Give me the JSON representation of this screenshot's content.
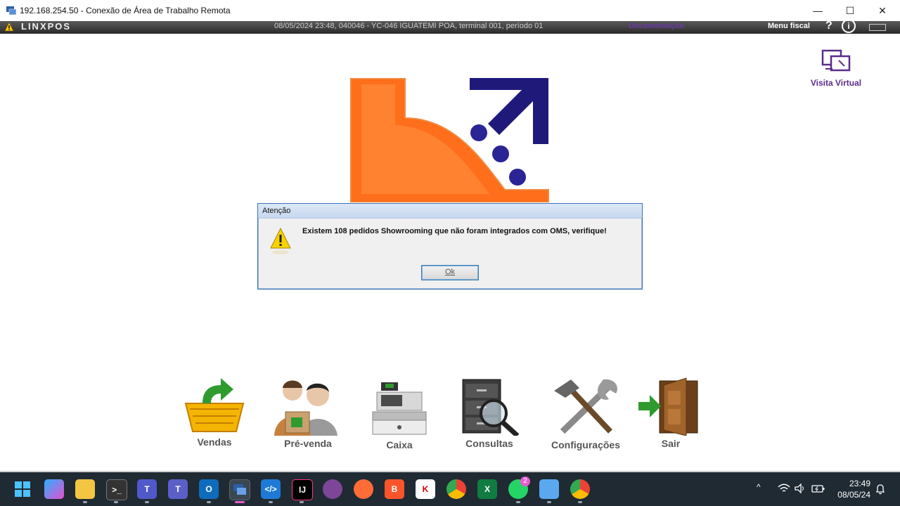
{
  "window": {
    "title": "192.168.254.50 - Conexão de Área de Trabalho Remota",
    "minimize": "—",
    "maximize": "☐",
    "close": "✕"
  },
  "app_header": {
    "brand": "LINXPOS",
    "status": "08/05/2024 23:48, 040046 - YC-046 IGUATEMI POA, terminal 001, período 01",
    "documentation_link": "Documentação",
    "fiscal_menu": "Menu fiscal",
    "help": "?",
    "info": "i",
    "accent_color": "#6a3ba8"
  },
  "visita_virtual": {
    "label": "Visita Virtual",
    "icon": "monitor-screens-icon"
  },
  "dialog": {
    "title": "Atenção",
    "message": "Existem 108 pedidos Showrooming que não foram integrados com OMS, verifique!",
    "ok_label": "Ok",
    "icon": "warning-icon"
  },
  "menu": [
    {
      "label": "Vendas",
      "icon": "shopping-basket-icon"
    },
    {
      "label": "Pré-venda",
      "icon": "customers-icon"
    },
    {
      "label": "Caixa",
      "icon": "cash-register-icon"
    },
    {
      "label": "Consultas",
      "icon": "file-cabinet-search-icon"
    },
    {
      "label": "Configurações",
      "icon": "tools-icon"
    },
    {
      "label": "Sair",
      "icon": "exit-door-icon"
    }
  ],
  "taskbar": {
    "apps": [
      {
        "name": "start",
        "glyph": ""
      },
      {
        "name": "copilot",
        "glyph": ""
      },
      {
        "name": "file-explorer",
        "glyph": ""
      },
      {
        "name": "terminal",
        "glyph": ">_"
      },
      {
        "name": "teams-new",
        "glyph": "T"
      },
      {
        "name": "teams",
        "glyph": "T"
      },
      {
        "name": "outlook",
        "glyph": "O"
      },
      {
        "name": "remote-desktop",
        "glyph": ""
      },
      {
        "name": "vscode",
        "glyph": "</>"
      },
      {
        "name": "intellij",
        "glyph": "IJ"
      },
      {
        "name": "tor-browser",
        "glyph": ""
      },
      {
        "name": "postman",
        "glyph": ""
      },
      {
        "name": "brave",
        "glyph": "B"
      },
      {
        "name": "kubernetes",
        "glyph": "K"
      },
      {
        "name": "chrome",
        "glyph": ""
      },
      {
        "name": "excel",
        "glyph": "X"
      },
      {
        "name": "whatsapp",
        "glyph": ""
      },
      {
        "name": "notepad",
        "glyph": ""
      },
      {
        "name": "chrome-profile",
        "glyph": ""
      }
    ],
    "whatsapp_badge": "2",
    "time": "23:49",
    "date": "08/05/24"
  }
}
